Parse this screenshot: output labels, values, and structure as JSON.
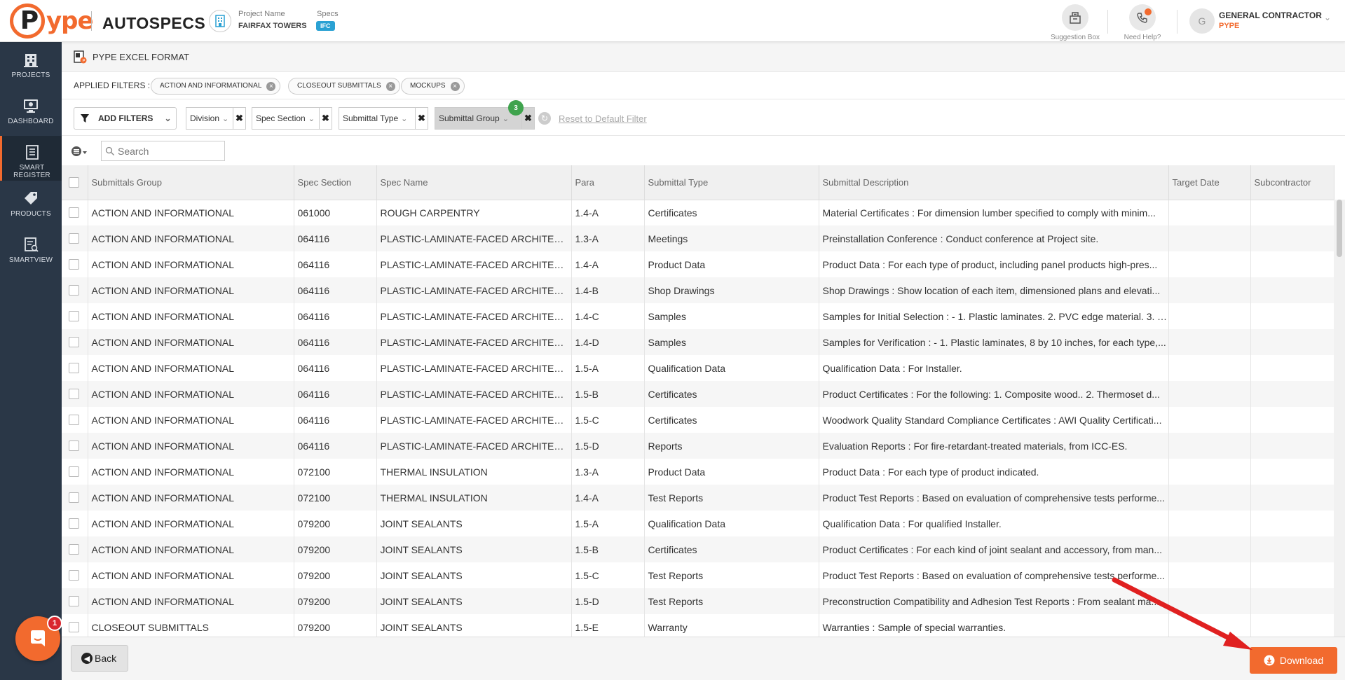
{
  "header": {
    "logo_text": "ype",
    "logo_letter": "P",
    "app_name": "AUTOSPECS",
    "project_label": "Project Name",
    "project_value": "FAIRFAX TOWERS",
    "specs_label": "Specs",
    "specs_badge": "IFC",
    "suggestion_label": "Suggestion Box",
    "help_label": "Need Help?",
    "user_initial": "G",
    "user_name": "GENERAL CONTRACTOR",
    "user_org": "PYPE"
  },
  "sidebar": {
    "items": [
      {
        "label": "PROJECTS",
        "icon": "building-icon"
      },
      {
        "label": "DASHBOARD",
        "icon": "monitor-icon"
      },
      {
        "label": "SMART REGISTER",
        "icon": "register-icon"
      },
      {
        "label": "PRODUCTS",
        "icon": "tag-icon"
      },
      {
        "label": "SMARTVIEW",
        "icon": "smartview-icon"
      }
    ],
    "active_index": 2,
    "chat_badge": "1"
  },
  "page": {
    "title": "PYPE EXCEL FORMAT"
  },
  "applied_filters": {
    "label": "APPLIED FILTERS :",
    "chips": [
      "ACTION AND INFORMATIONAL",
      "CLOSEOUT SUBMITTALS",
      "MOCKUPS"
    ]
  },
  "filters": {
    "add_label": "ADD FILTERS",
    "dropdowns": [
      "Division",
      "Spec Section",
      "Submittal Type",
      "Submittal Group"
    ],
    "selected_badge": "3",
    "reset_label": "Reset to Default Filter"
  },
  "search": {
    "placeholder": "Search"
  },
  "table": {
    "columns": [
      "Submittals Group",
      "Spec Section",
      "Spec Name",
      "Para",
      "Submittal Type",
      "Submittal Description",
      "Target Date",
      "Subcontractor"
    ],
    "rows": [
      [
        "ACTION AND INFORMATIONAL",
        "061000",
        "ROUGH CARPENTRY",
        "1.4-A",
        "Certificates",
        "Material Certificates : For dimension lumber specified to comply with minim...",
        "",
        ""
      ],
      [
        "ACTION AND INFORMATIONAL",
        "064116",
        "PLASTIC-LAMINATE-FACED ARCHITECTU...",
        "1.3-A",
        "Meetings",
        "Preinstallation Conference : Conduct conference at Project site.",
        "",
        ""
      ],
      [
        "ACTION AND INFORMATIONAL",
        "064116",
        "PLASTIC-LAMINATE-FACED ARCHITECTU...",
        "1.4-A",
        "Product Data",
        "Product Data : For each type of product, including panel products high-pres...",
        "",
        ""
      ],
      [
        "ACTION AND INFORMATIONAL",
        "064116",
        "PLASTIC-LAMINATE-FACED ARCHITECTU...",
        "1.4-B",
        "Shop Drawings",
        "Shop Drawings : Show location of each item, dimensioned plans and elevati...",
        "",
        ""
      ],
      [
        "ACTION AND INFORMATIONAL",
        "064116",
        "PLASTIC-LAMINATE-FACED ARCHITECTU...",
        "1.4-C",
        "Samples",
        "Samples for Initial Selection : - 1. Plastic laminates. 2. PVC edge material. 3. T...",
        "",
        ""
      ],
      [
        "ACTION AND INFORMATIONAL",
        "064116",
        "PLASTIC-LAMINATE-FACED ARCHITECTU...",
        "1.4-D",
        "Samples",
        "Samples for Verification : - 1. Plastic laminates, 8 by 10 inches, for each type,...",
        "",
        ""
      ],
      [
        "ACTION AND INFORMATIONAL",
        "064116",
        "PLASTIC-LAMINATE-FACED ARCHITECTU...",
        "1.5-A",
        "Qualification Data",
        "Qualification Data : For Installer.",
        "",
        ""
      ],
      [
        "ACTION AND INFORMATIONAL",
        "064116",
        "PLASTIC-LAMINATE-FACED ARCHITECTU...",
        "1.5-B",
        "Certificates",
        "Product Certificates : For the following: 1. Composite wood.. 2. Thermoset d...",
        "",
        ""
      ],
      [
        "ACTION AND INFORMATIONAL",
        "064116",
        "PLASTIC-LAMINATE-FACED ARCHITECTU...",
        "1.5-C",
        "Certificates",
        "Woodwork Quality Standard Compliance Certificates : AWI Quality Certificati...",
        "",
        ""
      ],
      [
        "ACTION AND INFORMATIONAL",
        "064116",
        "PLASTIC-LAMINATE-FACED ARCHITECTU...",
        "1.5-D",
        "Reports",
        "Evaluation Reports : For fire-retardant-treated materials, from ICC-ES.",
        "",
        ""
      ],
      [
        "ACTION AND INFORMATIONAL",
        "072100",
        "THERMAL INSULATION",
        "1.3-A",
        "Product Data",
        "Product Data : For each type of product indicated.",
        "",
        ""
      ],
      [
        "ACTION AND INFORMATIONAL",
        "072100",
        "THERMAL INSULATION",
        "1.4-A",
        "Test Reports",
        "Product Test Reports : Based on evaluation of comprehensive tests performe...",
        "",
        ""
      ],
      [
        "ACTION AND INFORMATIONAL",
        "079200",
        "JOINT SEALANTS",
        "1.5-A",
        "Qualification Data",
        "Qualification Data : For qualified Installer.",
        "",
        ""
      ],
      [
        "ACTION AND INFORMATIONAL",
        "079200",
        "JOINT SEALANTS",
        "1.5-B",
        "Certificates",
        "Product Certificates : For each kind of joint sealant and accessory, from man...",
        "",
        ""
      ],
      [
        "ACTION AND INFORMATIONAL",
        "079200",
        "JOINT SEALANTS",
        "1.5-C",
        "Test Reports",
        "Product Test Reports : Based on evaluation of comprehensive tests performe...",
        "",
        ""
      ],
      [
        "ACTION AND INFORMATIONAL",
        "079200",
        "JOINT SEALANTS",
        "1.5-D",
        "Test Reports",
        "Preconstruction Compatibility and Adhesion Test Reports : From sealant ma...",
        "",
        ""
      ],
      [
        "CLOSEOUT SUBMITTALS",
        "079200",
        "JOINT SEALANTS",
        "1.5-E",
        "Warranty",
        "Warranties : Sample of special warranties.",
        "",
        ""
      ]
    ]
  },
  "footer": {
    "back_label": "Back",
    "download_label": "Download"
  },
  "colors": {
    "brand": "#f26a2e",
    "sidebar_bg": "#2a3747",
    "badge_green": "#3fa34d",
    "arrow_red": "#e02020"
  }
}
